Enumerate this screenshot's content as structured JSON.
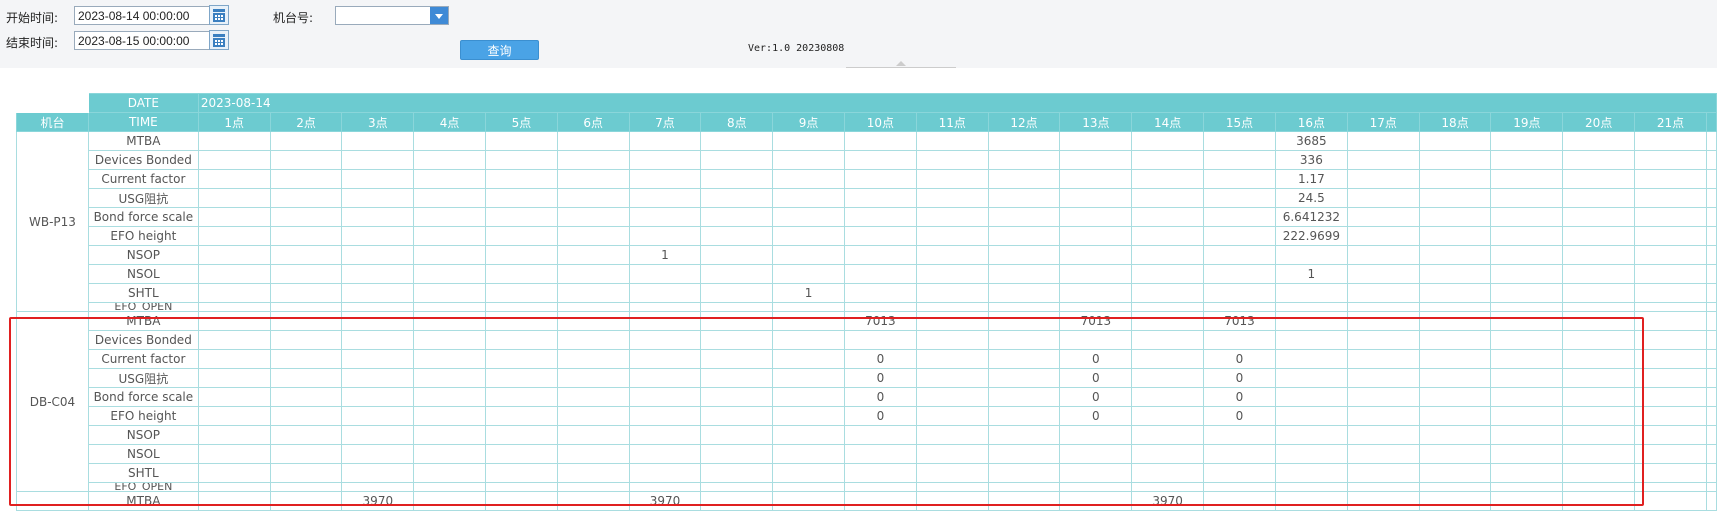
{
  "filters": {
    "start_label": "开始时间:",
    "start_value": "2023-08-14 00:00:00",
    "end_label": "结束时间:",
    "end_value": "2023-08-15 00:00:00",
    "machine_label": "机台号:",
    "machine_value": "",
    "query_label": "查询",
    "version": "Ver:1.0 20230808"
  },
  "table": {
    "date_label": "DATE",
    "date_value": "2023-08-14",
    "machine_header": "机台",
    "time_label": "TIME",
    "hours": [
      "1点",
      "2点",
      "3点",
      "4点",
      "5点",
      "6点",
      "7点",
      "8点",
      "9点",
      "10点",
      "11点",
      "12点",
      "13点",
      "14点",
      "15点",
      "16点",
      "17点",
      "18点",
      "19点",
      "20点",
      "21点"
    ],
    "groups": [
      {
        "machine": "WB-P13",
        "rows": [
          {
            "metric": "MTBA",
            "values": {
              "16点": "3685"
            }
          },
          {
            "metric": "Devices Bonded",
            "values": {
              "16点": "336"
            }
          },
          {
            "metric": "Current factor",
            "values": {
              "16点": "1.17"
            }
          },
          {
            "metric": "USG阻抗",
            "values": {
              "16点": "24.5"
            }
          },
          {
            "metric": "Bond force scale",
            "values": {
              "16点": "6.641232"
            }
          },
          {
            "metric": "EFO height",
            "values": {
              "16点": "222.9699"
            }
          },
          {
            "metric": "NSOP",
            "values": {
              "7点": "1"
            }
          },
          {
            "metric": "NSOL",
            "values": {
              "16点": "1"
            }
          },
          {
            "metric": "SHTL",
            "values": {
              "9点": "1"
            }
          },
          {
            "metric": "EFO_OPEN",
            "values": {}
          }
        ]
      },
      {
        "machine": "DB-C04",
        "rows": [
          {
            "metric": "MTBA",
            "values": {
              "10点": "7013",
              "13点": "7013",
              "15点": "7013"
            }
          },
          {
            "metric": "Devices Bonded",
            "values": {}
          },
          {
            "metric": "Current factor",
            "values": {
              "10点": "0",
              "13点": "0",
              "15点": "0"
            }
          },
          {
            "metric": "USG阻抗",
            "values": {
              "10点": "0",
              "13点": "0",
              "15点": "0"
            }
          },
          {
            "metric": "Bond force scale",
            "values": {
              "10点": "0",
              "13点": "0",
              "15点": "0"
            }
          },
          {
            "metric": "EFO height",
            "values": {
              "10点": "0",
              "13点": "0",
              "15点": "0"
            }
          },
          {
            "metric": "NSOP",
            "values": {}
          },
          {
            "metric": "NSOL",
            "values": {}
          },
          {
            "metric": "SHTL",
            "values": {}
          },
          {
            "metric": "EFO_OPEN",
            "values": {}
          }
        ]
      },
      {
        "machine": "",
        "rows": [
          {
            "metric": "MTBA",
            "values": {
              "3点": "3970",
              "7点": "3970",
              "14点": "3970"
            }
          }
        ]
      }
    ]
  },
  "colors": {
    "header_bg": "#6ccbd0",
    "highlight_border": "#e02020",
    "button_bg": "#4aa3e6"
  }
}
